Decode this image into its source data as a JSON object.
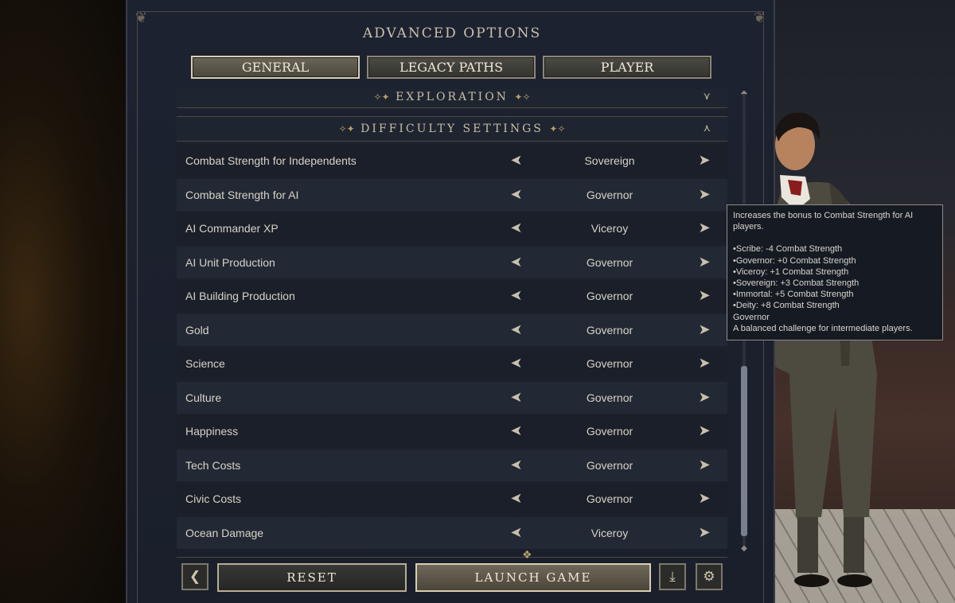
{
  "title": "ADVANCED OPTIONS",
  "tabs": [
    {
      "label": "GENERAL",
      "active": true
    },
    {
      "label": "LEGACY PATHS",
      "active": false
    },
    {
      "label": "PLAYER",
      "active": false
    }
  ],
  "sections": {
    "exploration": {
      "label": "EXPLORATION",
      "expanded": false
    },
    "difficulty": {
      "label": "DIFFICULTY SETTINGS",
      "expanded": true
    }
  },
  "settings": [
    {
      "label": "Combat Strength for Independents",
      "value": "Sovereign"
    },
    {
      "label": "Combat Strength for AI",
      "value": "Governor"
    },
    {
      "label": "AI Commander XP",
      "value": "Viceroy"
    },
    {
      "label": "AI Unit Production",
      "value": "Governor"
    },
    {
      "label": "AI Building Production",
      "value": "Governor"
    },
    {
      "label": "Gold",
      "value": "Governor"
    },
    {
      "label": "Science",
      "value": "Governor"
    },
    {
      "label": "Culture",
      "value": "Governor"
    },
    {
      "label": "Happiness",
      "value": "Governor"
    },
    {
      "label": "Tech Costs",
      "value": "Governor"
    },
    {
      "label": "Civic Costs",
      "value": "Governor"
    },
    {
      "label": "Ocean Damage",
      "value": "Viceroy"
    }
  ],
  "tooltip": {
    "intro": "Increases the bonus to Combat Strength for AI players.",
    "lines": [
      "•Scribe: -4 Combat Strength",
      "•Governor: +0 Combat Strength",
      "•Viceroy: +1 Combat Strength",
      "•Sovereign: +3 Combat Strength",
      "•Immortal: +5 Combat Strength",
      "•Deity: +8 Combat Strength"
    ],
    "selected_name": "Governor",
    "selected_desc": "A balanced challenge for intermediate players."
  },
  "footer": {
    "reset_label": "RESET",
    "launch_label": "LAUNCH GAME"
  },
  "icons": {
    "back": "chevron-left-icon",
    "download": "download-icon",
    "settings": "gear-icon"
  },
  "colors": {
    "panel_bg": "#1d2230",
    "accent_gold": "#b79d6b",
    "text": "#d7d3c8"
  },
  "scroll": {
    "position": 0.62
  }
}
